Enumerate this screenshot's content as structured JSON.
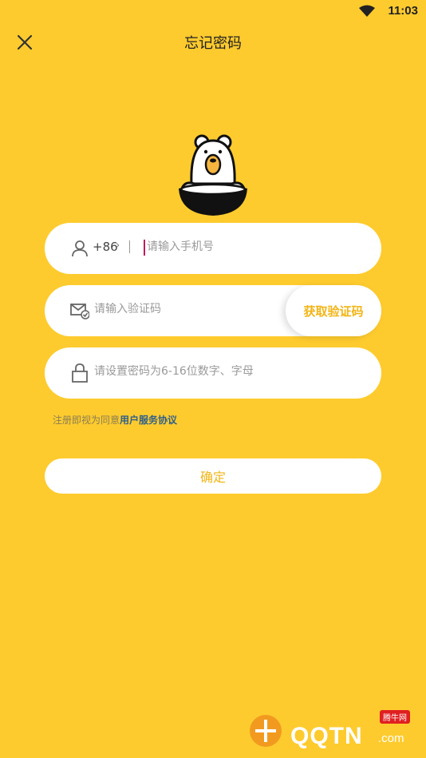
{
  "status_bar": {
    "time": "11:03"
  },
  "header": {
    "title": "忘记密码"
  },
  "form": {
    "phone": {
      "country_code": "+86",
      "chevron": "›",
      "placeholder": "请输入手机号"
    },
    "code": {
      "placeholder": "请输入验证码",
      "send_label": "获取验证码"
    },
    "password": {
      "placeholder": "请设置密码为6-16位数字、字母"
    },
    "agreement": {
      "prefix": "注册即视为同意",
      "link": "用户服务协议"
    },
    "confirm_label": "确定"
  },
  "watermark": {
    "text": "QQTN",
    "suffix": ".com",
    "badge": "腾牛网"
  },
  "colors": {
    "background": "#FECB2E",
    "accent": "#F2B516",
    "link": "#2f5f8a"
  }
}
